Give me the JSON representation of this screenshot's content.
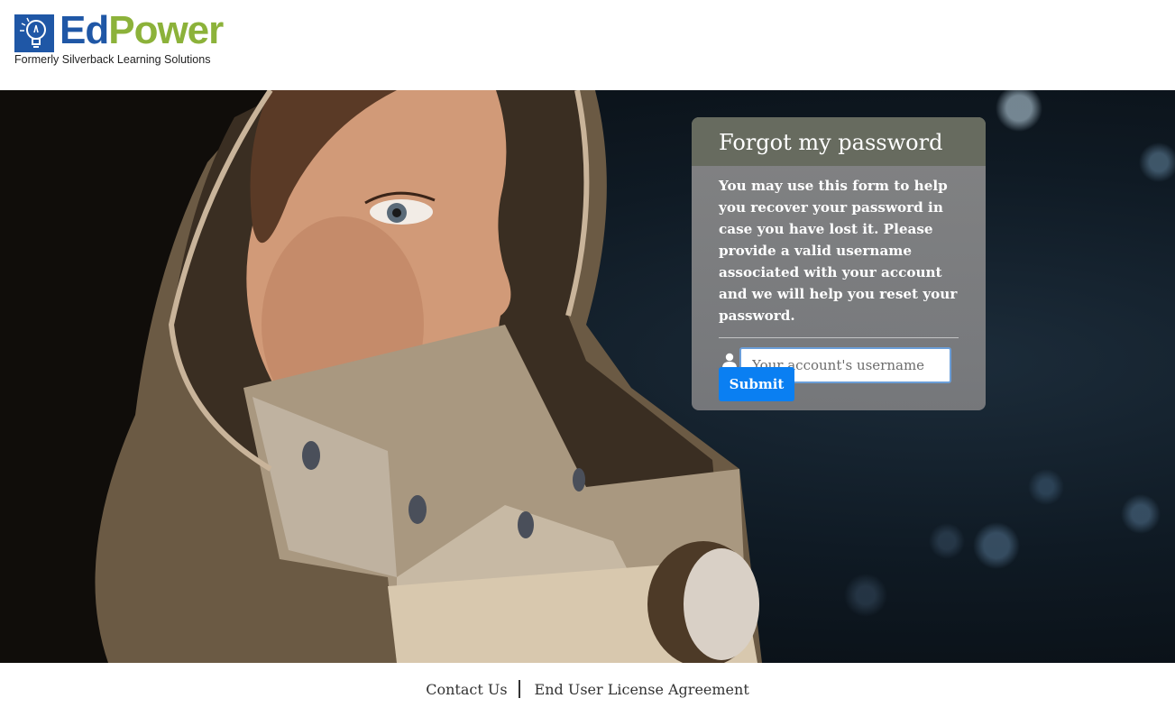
{
  "brand": {
    "name_part1": "Ed",
    "name_part2": "Power",
    "tagline": "Formerly Silverback Learning Solutions",
    "colors": {
      "blue": "#1f57a6",
      "green": "#8cb23a"
    },
    "icon": "lightbulb-icon"
  },
  "form": {
    "title": "Forgot my password",
    "description": "You may use this form to help you recover your password in case you have lost it. Please provide a valid username associated with your account and we will help you reset your password.",
    "username_placeholder": "Your account's username",
    "username_value": "",
    "username_icon": "user-icon",
    "submit_label": "Submit",
    "colors": {
      "header": "#676b5f",
      "submit": "#0a7ff2"
    }
  },
  "footer": {
    "contact_label": "Contact Us",
    "eula_label": "End User License Agreement"
  }
}
